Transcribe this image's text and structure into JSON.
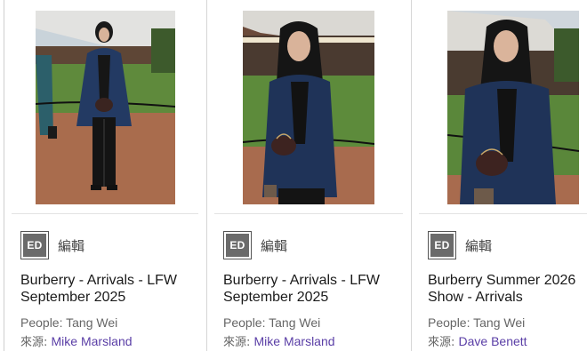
{
  "cards": [
    {
      "agency_badge": "ED",
      "agency_name": "編輯",
      "title": "Burberry - Arrivals - LFW September 2025",
      "people_label": "People: Tang Wei",
      "source_label": "來源: ",
      "source_link": "Mike Marsland",
      "photo_icon": "photo-thumbnail"
    },
    {
      "agency_badge": "ED",
      "agency_name": "編輯",
      "title": "Burberry - Arrivals - LFW September 2025",
      "people_label": "People: Tang Wei",
      "source_label": "來源: ",
      "source_link": "Mike Marsland",
      "photo_icon": "photo-thumbnail"
    },
    {
      "agency_badge": "ED",
      "agency_name": "編輯",
      "title": "Burberry Summer 2026 Show - Arrivals",
      "people_label": "People: Tang Wei",
      "source_label": "來源: ",
      "source_link": "Dave Benett",
      "photo_icon": "photo-thumbnail"
    }
  ],
  "colors": {
    "link": "#5a3ea6",
    "badge_bg": "#6b6b6b",
    "coat_navy": "#1f3358",
    "gravel": "#a86a4e",
    "grass": "#4d7a34"
  }
}
